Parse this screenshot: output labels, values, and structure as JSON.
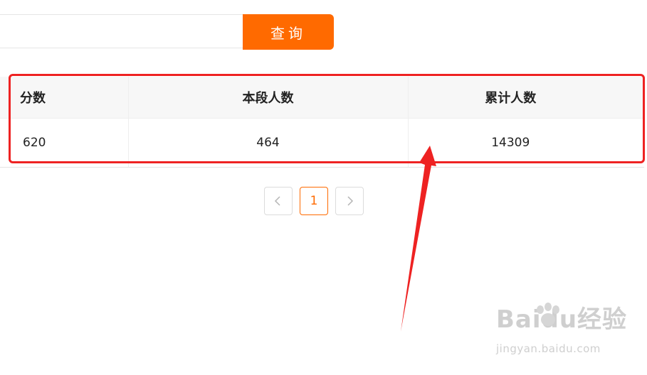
{
  "search": {
    "placeholder": "",
    "value": "",
    "button_label": "查询",
    "accent_color": "#ff6a00"
  },
  "table": {
    "headers": [
      "分数",
      "本段人数",
      "累计人数"
    ],
    "rows": [
      [
        "620",
        "464",
        "14309"
      ]
    ]
  },
  "pagination": {
    "prev_icon": "chevron-left-icon",
    "current_page": "1",
    "next_icon": "chevron-right-icon"
  },
  "annotation": {
    "color": "#ee2222"
  },
  "watermark": {
    "logo_text": "Baidu经验",
    "url": "jingyan.baidu.com"
  }
}
